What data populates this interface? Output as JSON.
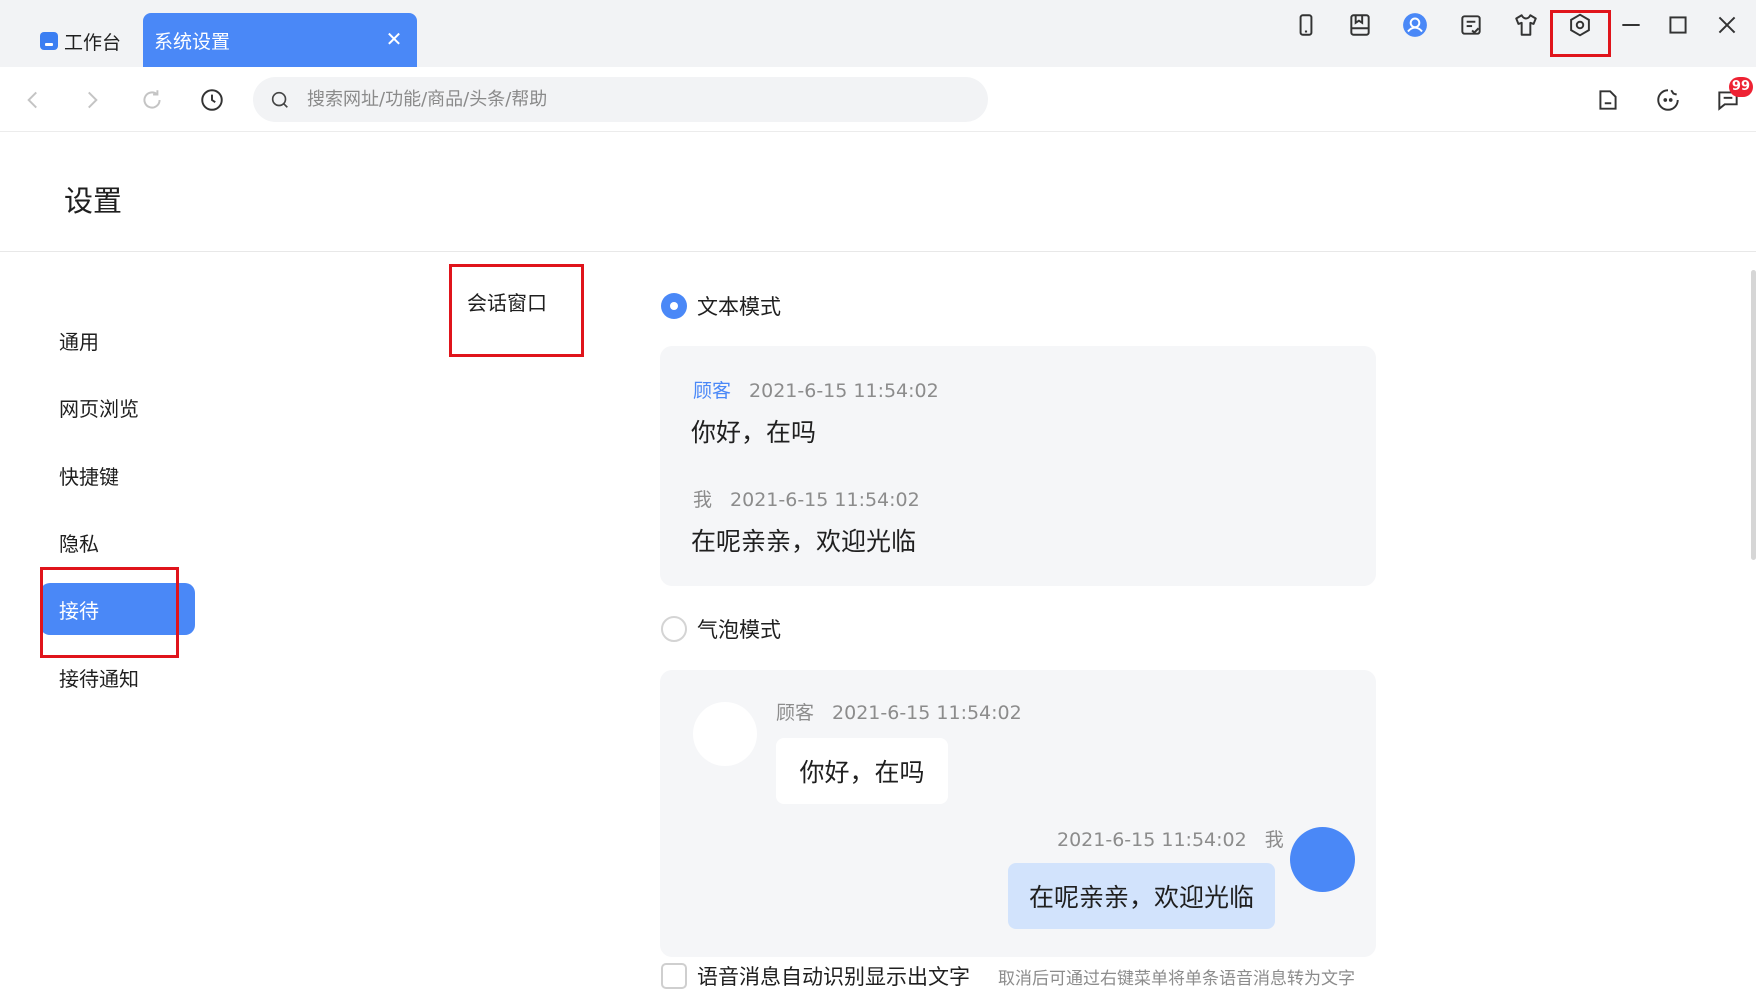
{
  "tabs": {
    "home_label": "工作台",
    "active_label": "系统设置",
    "close_glyph": "✕"
  },
  "window_controls": {
    "icons": [
      "phone-icon",
      "bookmark-icon",
      "user-circle-icon",
      "checklist-icon",
      "shirt-icon",
      "settings-hexagon-icon",
      "minimize-icon",
      "maximize-icon",
      "close-icon"
    ]
  },
  "navbar": {
    "search_placeholder": "搜索网址/功能/商品/头条/帮助",
    "message_badge": "99"
  },
  "page": {
    "title": "设置"
  },
  "sidebar": {
    "items": [
      {
        "label": "通用",
        "active": false
      },
      {
        "label": "网页浏览",
        "active": false
      },
      {
        "label": "快捷键",
        "active": false
      },
      {
        "label": "隐私",
        "active": false
      },
      {
        "label": "接待",
        "active": true
      },
      {
        "label": "接待通知",
        "active": false
      }
    ]
  },
  "section": {
    "label": "会话窗口"
  },
  "text_mode": {
    "label": "文本模式",
    "selected": true,
    "customer_name": "顾客",
    "customer_time": "2021-6-15 11:54:02",
    "customer_message": "你好，在吗",
    "me_name": "我",
    "me_time": "2021-6-15 11:54:02",
    "me_message": "在呢亲亲，欢迎光临"
  },
  "bubble_mode": {
    "label": "气泡模式",
    "selected": false,
    "customer_name": "顾客",
    "customer_time": "2021-6-15 11:54:02",
    "customer_message": "你好，在吗",
    "me_name": "我",
    "me_time": "2021-6-15 11:54:02",
    "me_message": "在呢亲亲，欢迎光临"
  },
  "voice_option": {
    "label": "语音消息自动识别显示出文字",
    "hint": "取消后可通过右键菜单将单条语音消息转为文字",
    "checked": false
  },
  "colors": {
    "accent": "#4a88f7",
    "highlight_box": "#e0141b",
    "badge": "#ee2233"
  }
}
